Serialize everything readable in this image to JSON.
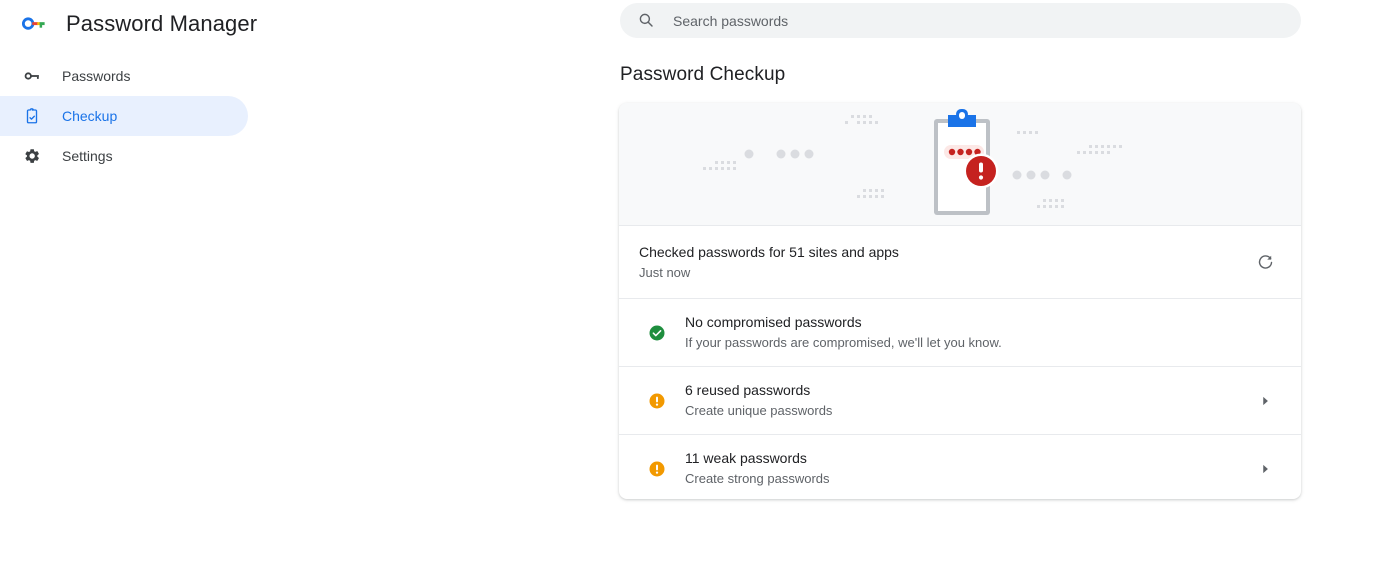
{
  "app": {
    "title": "Password Manager",
    "logo_icon": "key-icon"
  },
  "sidebar": {
    "items": [
      {
        "label": "Passwords",
        "icon": "key-icon",
        "active": false
      },
      {
        "label": "Checkup",
        "icon": "clipboard-check-icon",
        "active": true
      },
      {
        "label": "Settings",
        "icon": "gear-icon",
        "active": false
      }
    ]
  },
  "search": {
    "placeholder": "Search passwords",
    "value": "",
    "icon": "search-icon"
  },
  "main": {
    "page_title": "Password Checkup"
  },
  "card": {
    "illustration": {
      "icon": "clipboard-password-alert-illustration",
      "background": "#f8f9fa"
    },
    "status": {
      "title": "Checked passwords for 51 sites and apps",
      "subtitle": "Just now",
      "refresh_icon": "refresh-icon"
    },
    "results": [
      {
        "title": "No compromised passwords",
        "subtitle": "If your passwords are compromised, we'll let you know.",
        "icon": "check-circle-icon",
        "icon_color": "#1e8e3e",
        "has_chevron": false
      },
      {
        "title": "6 reused passwords",
        "subtitle": "Create unique passwords",
        "icon": "warning-circle-icon",
        "icon_color": "#f29900",
        "has_chevron": true
      },
      {
        "title": "11 weak passwords",
        "subtitle": "Create strong passwords",
        "icon": "warning-circle-icon",
        "icon_color": "#f29900",
        "has_chevron": true
      }
    ]
  },
  "colors": {
    "accent": "#1a73e8",
    "active_pill": "#e8f0fe",
    "text_primary": "#202124",
    "text_secondary": "#5f6368",
    "divider": "#e8eaed",
    "banner_bg": "#f8f9fa",
    "search_bg": "#f1f3f4",
    "ok": "#1e8e3e",
    "warn": "#f29900",
    "alert_red": "#c5221f"
  }
}
